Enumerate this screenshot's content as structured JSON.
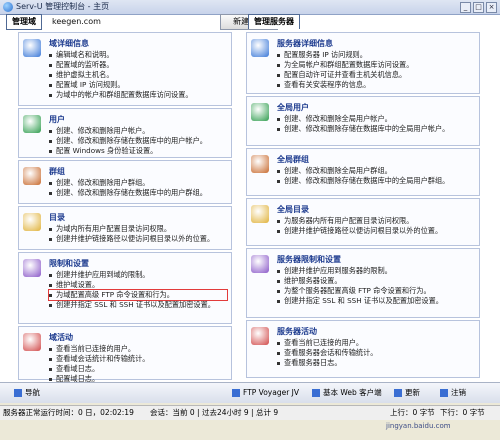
{
  "window": {
    "title": "Serv-U 管理控制台 - 主页",
    "controls": [
      "_",
      "□",
      "×"
    ]
  },
  "toolbar": {
    "admin_tab": "管理域",
    "domain": "keegen.com",
    "new_button": "新建域...",
    "server_tab": "管理服务器"
  },
  "left_sections": [
    {
      "title": "域详细信息",
      "icon": "domain-details-icon",
      "items": [
        "编辑域名和说明。",
        "配置域的监听器。",
        "维护虚拟主机名。",
        "配置域 IP 访问规则。",
        "为域中的帐户和群组配置数据库访问设置。"
      ]
    },
    {
      "title": "用户",
      "icon": "users-icon",
      "items": [
        "创建、修改和删除用户帐户。",
        "创建、修改和删除存储在数据库中的用户帐户。",
        "配置 Windows 身份验证设置。"
      ]
    },
    {
      "title": "群组",
      "icon": "groups-icon",
      "items": [
        "创建、修改和删除用户群组。",
        "创建、修改和删除存储在数据库中的用户群组。"
      ]
    },
    {
      "title": "目录",
      "icon": "directory-icon",
      "items": [
        "为域内所有用户配置目录访问权限。",
        "创建并维护链接路径以便访问根目录以外的位置。"
      ]
    },
    {
      "title": "限制和设置",
      "icon": "limits-settings-icon",
      "items": [
        "创建并维护应用到域的限制。",
        "维护域设置。",
        "为域配置高级 FTP 命令设置和行为。",
        "创建并指定 SSL 和 SSH 证书以及配置加密设置。"
      ]
    },
    {
      "title": "域活动",
      "icon": "domain-activity-icon",
      "items": [
        "查看当前已连接的用户。",
        "查看域会话统计和传输统计。",
        "查看域日志。",
        "配置域日志。"
      ]
    }
  ],
  "right_sections": [
    {
      "title": "服务器详细信息",
      "icon": "server-details-icon",
      "items": [
        "配置服务器 IP 访问规则。",
        "为全局帐户和群组配置数据库访问设置。",
        "配置自动许可证并查看主机关机信息。",
        "查看有关安装程序的信息。"
      ]
    },
    {
      "title": "全局用户",
      "icon": "global-users-icon",
      "items": [
        "创建、修改和删除全局用户帐户。",
        "创建、修改和删除存储在数据库中的全局用户帐户。"
      ]
    },
    {
      "title": "全局群组",
      "icon": "global-groups-icon",
      "items": [
        "创建、修改和删除全局用户群组。",
        "创建、修改和删除存储在数据库中的全局用户群组。"
      ]
    },
    {
      "title": "全局目录",
      "icon": "global-directory-icon",
      "items": [
        "为服务器内所有用户配置目录访问权限。",
        "创建并维护链接路径以便访问根目录以外的位置。"
      ]
    },
    {
      "title": "服务器限制和设置",
      "icon": "server-limits-icon",
      "items": [
        "创建并维护应用到服务器的限制。",
        "维护服务器设置。",
        "为整个服务器配置高级 FTP 命令设置和行为。",
        "创建并指定 SSL 和 SSH 证书以及配置加密设置。"
      ]
    },
    {
      "title": "服务器活动",
      "icon": "server-activity-icon",
      "items": [
        "查看当前已连接的用户。",
        "查看服务器会话和传输统计。",
        "查看服务器日志。"
      ]
    }
  ],
  "highlighted_item": "为域配置高级 FTP 命令设置和行为。",
  "taskbar": {
    "items": [
      {
        "label": "导航",
        "icon": "navigation-icon"
      },
      {
        "label": "FTP Voyager JV",
        "icon": "ftp-voyager-icon"
      },
      {
        "label": "基本 Web 客户端",
        "icon": "web-client-icon"
      },
      {
        "label": "更新",
        "icon": "update-icon"
      },
      {
        "label": "注销",
        "icon": "logout-icon"
      }
    ]
  },
  "status": {
    "uptime": "服务器正常运行时间：0 日，02:02:19",
    "sessions": "会话：当前 0 | 过去24小时 9 | 总计 9",
    "upload": "上行：0 字节",
    "download": "下行：0 字节"
  },
  "watermark": "jingyan.baidu.com",
  "colors": {
    "title_blue": "#1d3b8f",
    "highlight_red": "#e23b3b"
  }
}
